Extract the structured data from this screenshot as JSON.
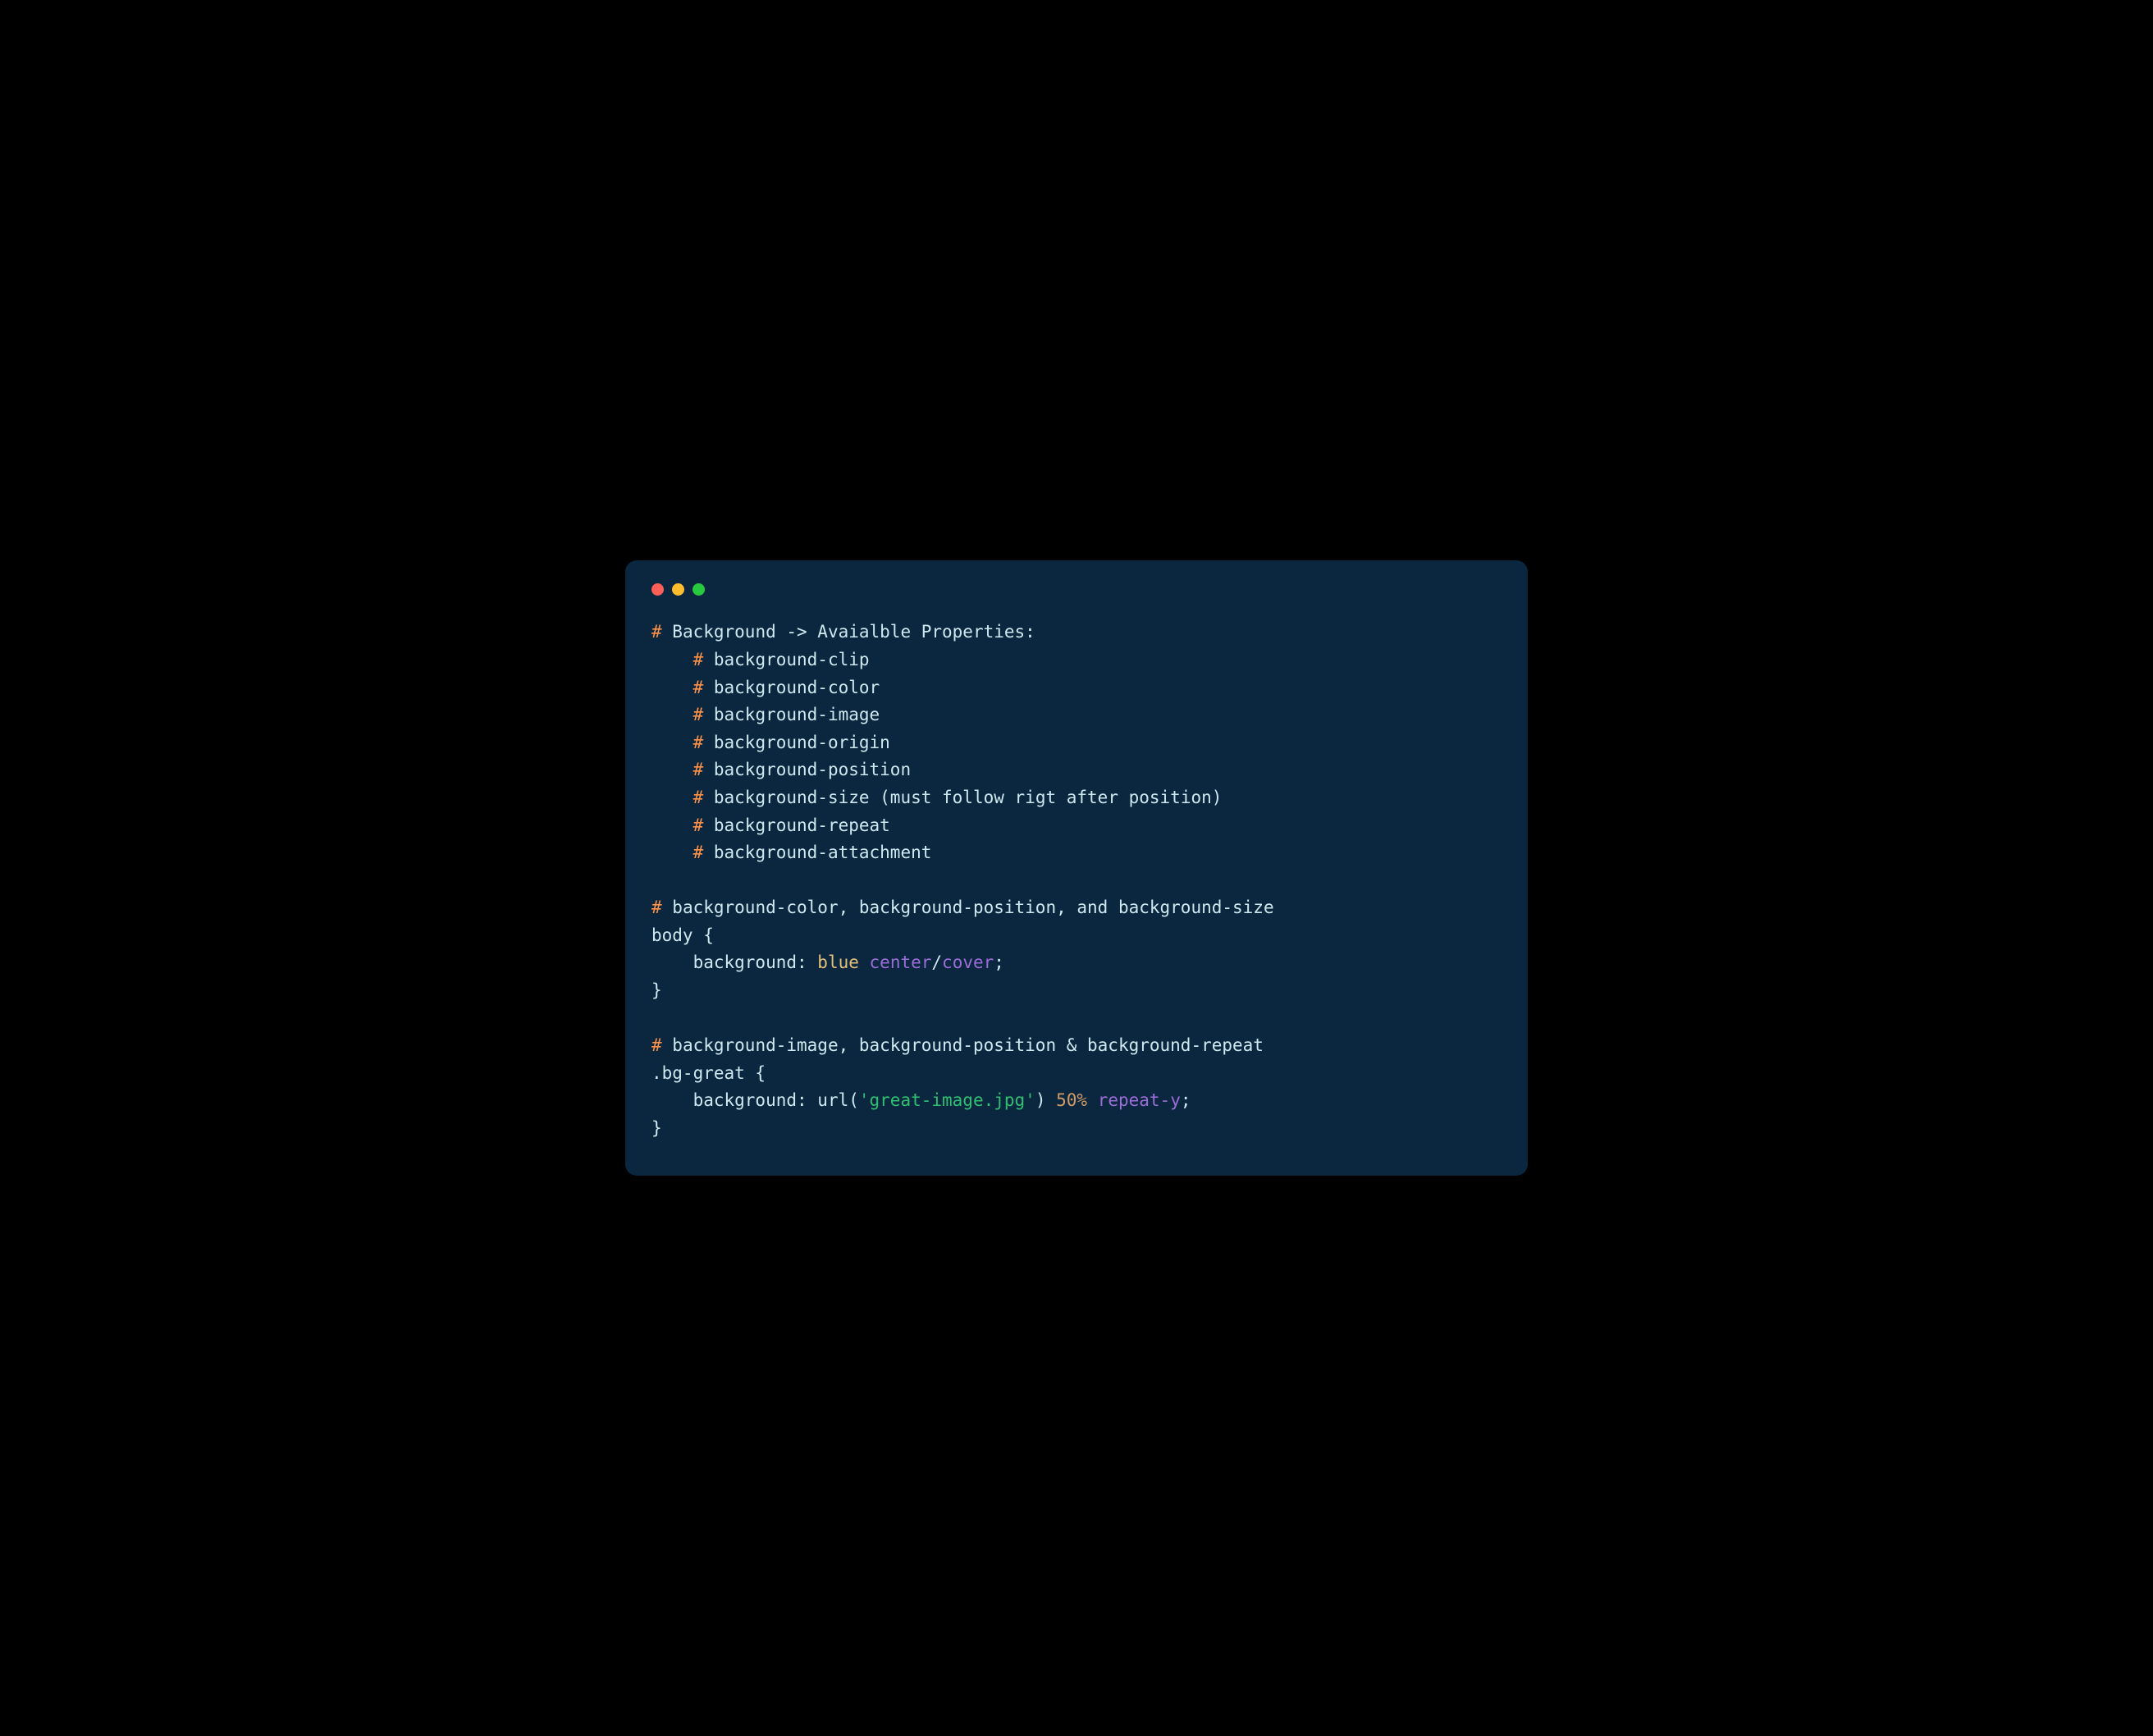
{
  "code": {
    "l1_hash": "#",
    "l1_text": " Background -> Avaialble Properties:",
    "l2_hash": "#",
    "l2_text": " background-clip",
    "l3_hash": "#",
    "l3_text": " background-color",
    "l4_hash": "#",
    "l4_text": " background-image",
    "l5_hash": "#",
    "l5_text": " background-origin",
    "l6_hash": "#",
    "l6_text": " background-position",
    "l7_hash": "#",
    "l7_text": " background-size (must follow rigt after position)",
    "l8_hash": "#",
    "l8_text": " background-repeat",
    "l9_hash": "#",
    "l9_text": " background-attachment",
    "l10_hash": "#",
    "l10_text": " background-color, background-position, and background-size",
    "l11_sel": "body {",
    "l12_prop": "    background: ",
    "l12_blue": "blue",
    "l12_sp1": " ",
    "l12_center": "center",
    "l12_slash": "/",
    "l12_cover": "cover",
    "l12_semi": ";",
    "l13_close": "}",
    "l14_hash": "#",
    "l14_text": " background-image, background-position & background-repeat",
    "l15_sel": ".bg-great {",
    "l16_prop": "    background: ",
    "l16_url": "url(",
    "l16_str": "'great-image.jpg'",
    "l16_url_close": ") ",
    "l16_num": "50%",
    "l16_sp": " ",
    "l16_repeat": "repeat-y",
    "l16_semi": ";",
    "l17_close": "}"
  }
}
